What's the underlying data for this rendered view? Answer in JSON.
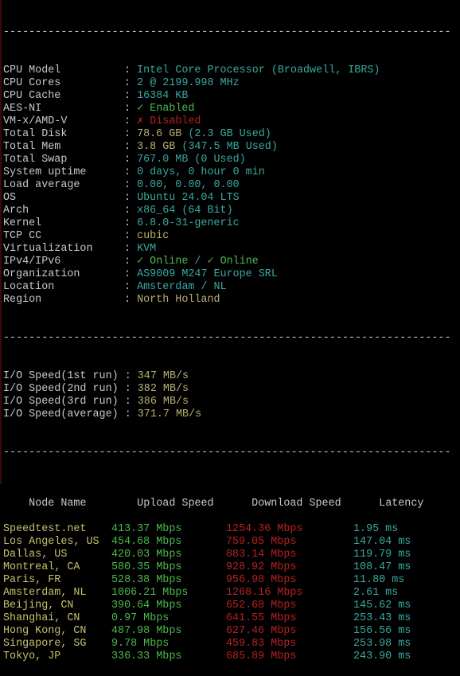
{
  "separator": "----------------------------------------------------------------------",
  "system_info": [
    {
      "label": "CPU Model",
      "parts": [
        {
          "text": "Intel Core Processor (Broadwell, IBRS)",
          "color": "cyan"
        }
      ]
    },
    {
      "label": "CPU Cores",
      "parts": [
        {
          "text": "2 @ 2199.998 MHz",
          "color": "cyan"
        }
      ]
    },
    {
      "label": "CPU Cache",
      "parts": [
        {
          "text": "16384 KB",
          "color": "cyan"
        }
      ]
    },
    {
      "label": "AES-NI",
      "parts": [
        {
          "text": "✓ Enabled",
          "color": "green"
        }
      ]
    },
    {
      "label": "VM-x/AMD-V",
      "parts": [
        {
          "text": "✗ Disabled",
          "color": "red"
        }
      ]
    },
    {
      "label": "Total Disk",
      "parts": [
        {
          "text": "78.6 GB",
          "color": "yellow"
        },
        {
          "text": " (2.3 GB Used)",
          "color": "cyan"
        }
      ]
    },
    {
      "label": "Total Mem",
      "parts": [
        {
          "text": "3.8 GB",
          "color": "yellow"
        },
        {
          "text": " (347.5 MB Used)",
          "color": "cyan"
        }
      ]
    },
    {
      "label": "Total Swap",
      "parts": [
        {
          "text": "767.0 MB (0 Used)",
          "color": "cyan"
        }
      ]
    },
    {
      "label": "System uptime",
      "parts": [
        {
          "text": "0 days, 0 hour 0 min",
          "color": "cyan"
        }
      ]
    },
    {
      "label": "Load average",
      "parts": [
        {
          "text": "0.00, 0.00, 0.00",
          "color": "cyan"
        }
      ]
    },
    {
      "label": "OS",
      "parts": [
        {
          "text": "Ubuntu 24.04 LTS",
          "color": "cyan"
        }
      ]
    },
    {
      "label": "Arch",
      "parts": [
        {
          "text": "x86_64 (64 Bit)",
          "color": "cyan"
        }
      ]
    },
    {
      "label": "Kernel",
      "parts": [
        {
          "text": "6.8.0-31-generic",
          "color": "cyan"
        }
      ]
    },
    {
      "label": "TCP CC",
      "parts": [
        {
          "text": "cubic",
          "color": "yellow"
        }
      ]
    },
    {
      "label": "Virtualization",
      "parts": [
        {
          "text": "KVM",
          "color": "cyan"
        }
      ]
    },
    {
      "label": "IPv4/IPv6",
      "parts": [
        {
          "text": "✓ Online",
          "color": "green"
        },
        {
          "text": " / ",
          "color": "cyan"
        },
        {
          "text": "✓ Online",
          "color": "green"
        }
      ]
    },
    {
      "label": "Organization",
      "parts": [
        {
          "text": "AS9009 M247 Europe SRL",
          "color": "cyan"
        }
      ]
    },
    {
      "label": "Location",
      "parts": [
        {
          "text": "Amsterdam / NL",
          "color": "cyan"
        }
      ]
    },
    {
      "label": "Region",
      "parts": [
        {
          "text": "North Holland",
          "color": "yellow"
        }
      ]
    }
  ],
  "io_speed": [
    {
      "label": "I/O Speed(1st run)",
      "value": "347 MB/s"
    },
    {
      "label": "I/O Speed(2nd run)",
      "value": "382 MB/s"
    },
    {
      "label": "I/O Speed(3rd run)",
      "value": "386 MB/s"
    },
    {
      "label": "I/O Speed(average)",
      "value": "371.7 MB/s"
    }
  ],
  "speedtest": {
    "headers": {
      "node": "Node Name",
      "upload": "Upload Speed",
      "download": "Download Speed",
      "latency": "Latency"
    },
    "rows": [
      {
        "node": "Speedtest.net",
        "upload": "413.37 Mbps",
        "download": "1254.36 Mbps",
        "latency": "1.95 ms"
      },
      {
        "node": "Los Angeles, US",
        "upload": "454.68 Mbps",
        "download": "759.05 Mbps",
        "latency": "147.04 ms"
      },
      {
        "node": "Dallas, US",
        "upload": "420.03 Mbps",
        "download": "883.14 Mbps",
        "latency": "119.79 ms"
      },
      {
        "node": "Montreal, CA",
        "upload": "580.35 Mbps",
        "download": "928.92 Mbps",
        "latency": "108.47 ms"
      },
      {
        "node": "Paris, FR",
        "upload": "528.38 Mbps",
        "download": "956.98 Mbps",
        "latency": "11.80 ms"
      },
      {
        "node": "Amsterdam, NL",
        "upload": "1006.21 Mbps",
        "download": "1268.16 Mbps",
        "latency": "2.61 ms"
      },
      {
        "node": "Beijing, CN",
        "upload": "390.64 Mbps",
        "download": "652.68 Mbps",
        "latency": "145.62 ms"
      },
      {
        "node": "Shanghai, CN",
        "upload": "0.97 Mbps",
        "download": "641.55 Mbps",
        "latency": "253.43 ms"
      },
      {
        "node": "Hong Kong, CN",
        "upload": "487.98 Mbps",
        "download": "627.46 Mbps",
        "latency": "156.56 ms"
      },
      {
        "node": "Singapore, SG",
        "upload": "9.78 Mbps",
        "download": "459.83 Mbps",
        "latency": "253.98 ms"
      },
      {
        "node": "Tokyo, JP",
        "upload": "336.33 Mbps",
        "download": "685.89 Mbps",
        "latency": "243.90 ms"
      }
    ]
  },
  "colors": {
    "cyan": "#3aa8a0",
    "yellow": "#b8b070",
    "green": "#4db84d",
    "red": "#b82020"
  }
}
